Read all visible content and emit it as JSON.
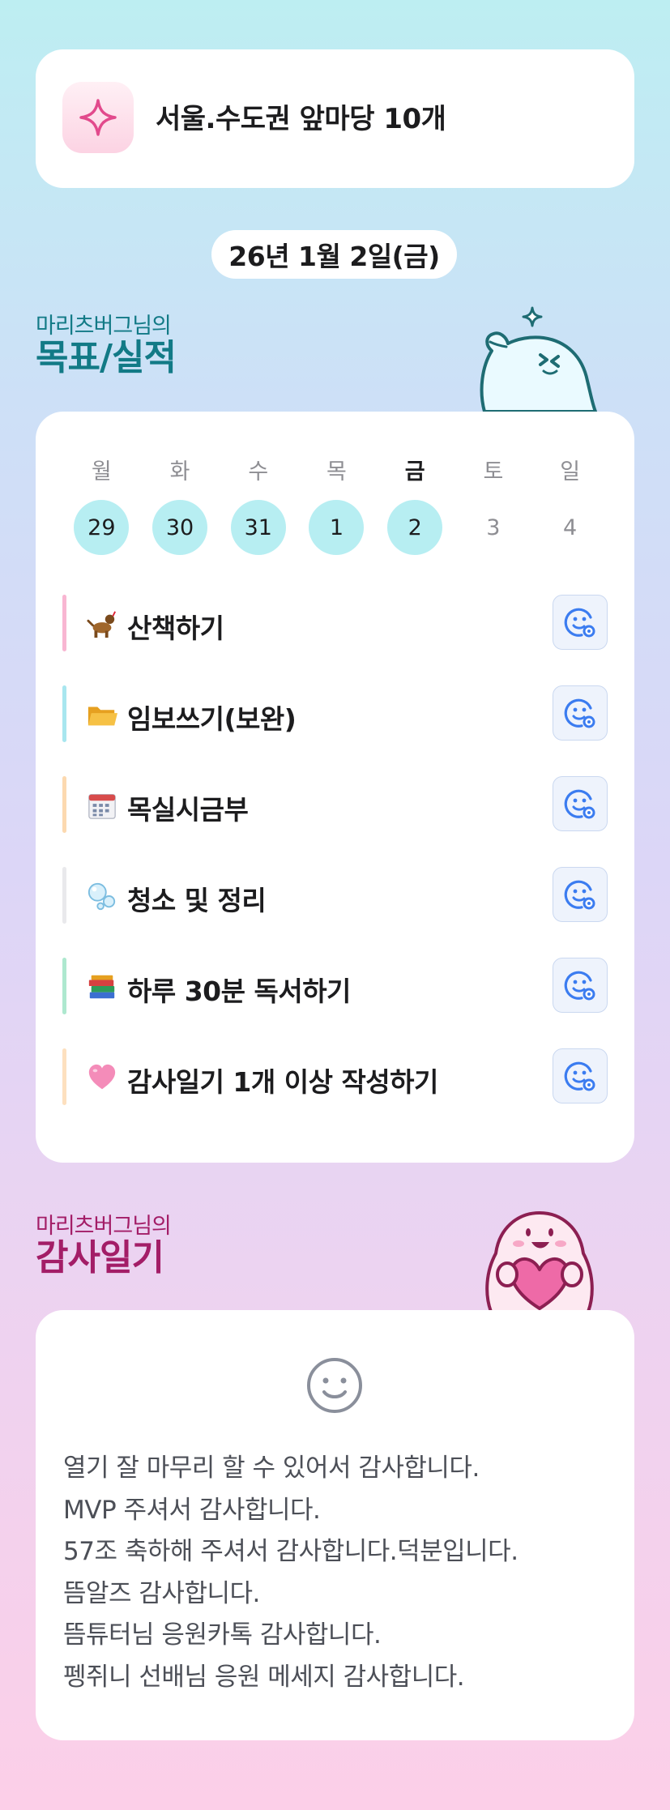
{
  "banner": {
    "title": "서울.수도권 앞마당 10개",
    "icon": "sparkle-icon"
  },
  "date": "26년 1월 2일(금)",
  "goals_section": {
    "subtitle": "마리츠버그님의",
    "title": "목표/실적"
  },
  "week": {
    "days": [
      {
        "label": "월",
        "num": "29",
        "done": true
      },
      {
        "label": "화",
        "num": "30",
        "done": true
      },
      {
        "label": "수",
        "num": "31",
        "done": true
      },
      {
        "label": "목",
        "num": "1",
        "done": true
      },
      {
        "label": "금",
        "num": "2",
        "done": true,
        "today": true
      },
      {
        "label": "토",
        "num": "3",
        "done": false
      },
      {
        "label": "일",
        "num": "4",
        "done": false
      }
    ]
  },
  "tasks": [
    {
      "emoji": "dog-icon",
      "label": "산책하기",
      "color": "#f8b6d2"
    },
    {
      "emoji": "folder-icon",
      "label": "임보쓰기(보완)",
      "color": "#a8e6ef"
    },
    {
      "emoji": "calendar-icon",
      "label": "목실시금부",
      "color": "#fcd9b0"
    },
    {
      "emoji": "bubbles-icon",
      "label": "청소 및 정리",
      "color": "#e9e9ec"
    },
    {
      "emoji": "books-icon",
      "label": "하루 30분 독서하기",
      "color": "#aee8cf"
    },
    {
      "emoji": "heart-icon",
      "label": "감사일기 1개 이상 작성하기",
      "color": "#fde0bf"
    }
  ],
  "thanks_section": {
    "subtitle": "마리츠버그님의",
    "title": "감사일기"
  },
  "thanks": {
    "lines": [
      "열기 잘 마무리 할 수 있어서 감사합니다.",
      "MVP 주셔서 감사합니다.",
      "57조 축하해 주셔서 감사합니다.덕분입니다.",
      "뜸알즈 감사합니다.",
      "뜸튜터님 응원카톡 감사합니다.",
      "펭쥐니 선배님 응원 메세지 감사합니다."
    ]
  },
  "colors": {
    "accent_teal": "#127a86",
    "accent_magenta": "#a31d67",
    "day_done": "#b7eef2",
    "react_button": "#3b7cf0"
  }
}
